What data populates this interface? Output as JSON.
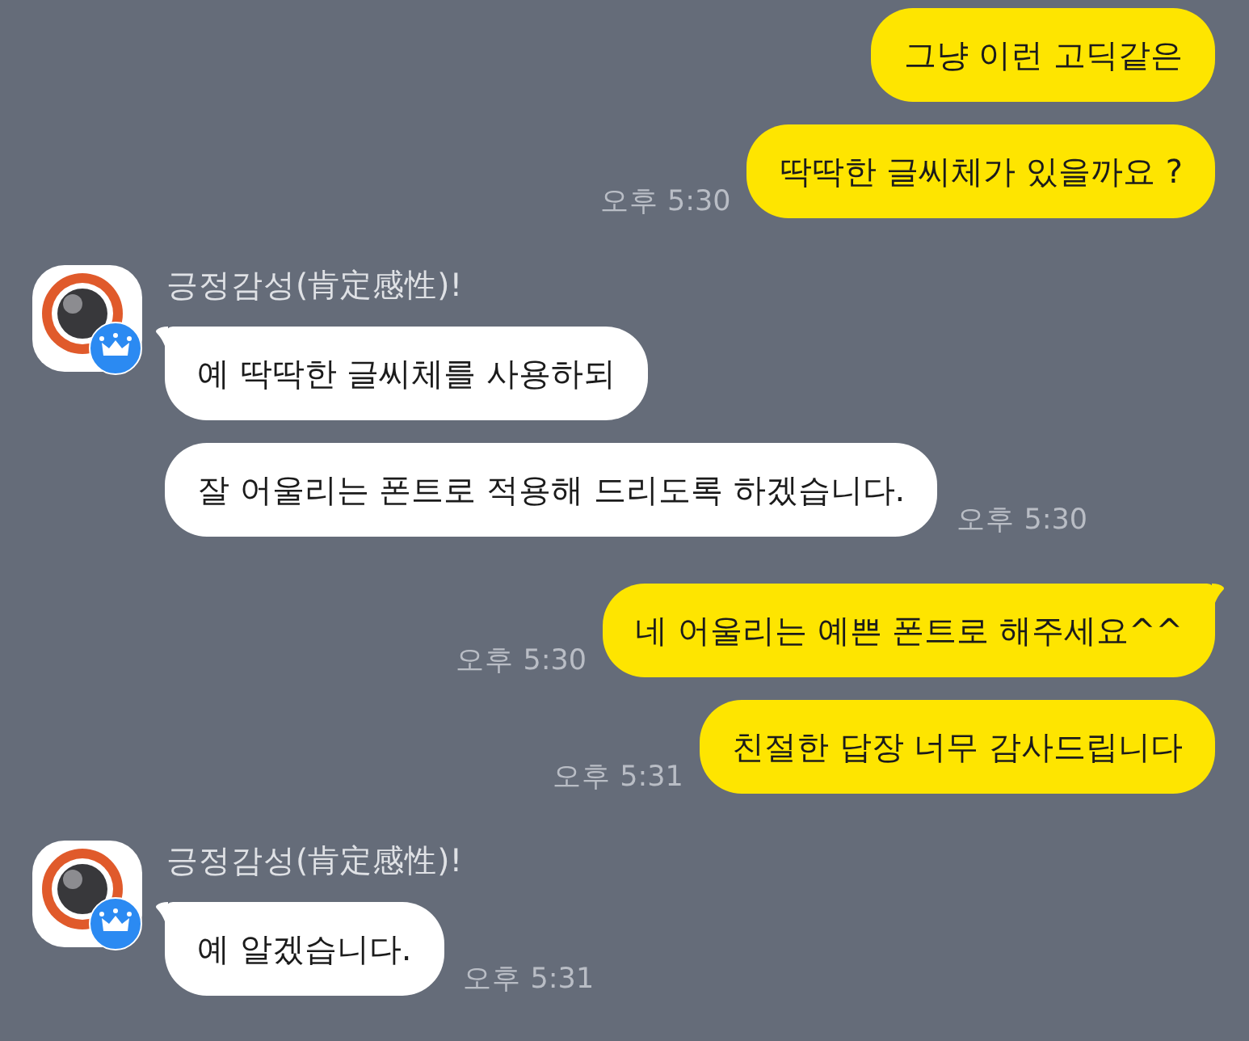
{
  "chat": [
    {
      "kind": "outgoing",
      "messages": [
        {
          "text": "그냥 이런 고딕같은",
          "tail": false
        },
        {
          "text": "딱딱한 글씨체가 있을까요 ?",
          "tail": false,
          "time": "오후 5:30"
        }
      ]
    },
    {
      "kind": "incoming",
      "sender": "긍정감성(肯定感性)!",
      "messages": [
        {
          "text": "예 딱딱한 글씨체를 사용하되",
          "tail": true
        },
        {
          "text": "잘 어울리는 폰트로 적용해 드리도록 하겠습니다.",
          "tail": false,
          "time": "오후 5:30"
        }
      ]
    },
    {
      "kind": "outgoing",
      "messages": [
        {
          "text": "네 어울리는 예쁜 폰트로 해주세요^^",
          "tail": true,
          "time": "오후 5:30"
        },
        {
          "text": "친절한 답장 너무 감사드립니다",
          "tail": false,
          "time": "오후 5:31"
        }
      ]
    },
    {
      "kind": "incoming",
      "sender": "긍정감성(肯定感性)!",
      "messages": [
        {
          "text": "예 알겠습니다.",
          "tail": true,
          "time": "오후 5:31"
        }
      ]
    }
  ]
}
